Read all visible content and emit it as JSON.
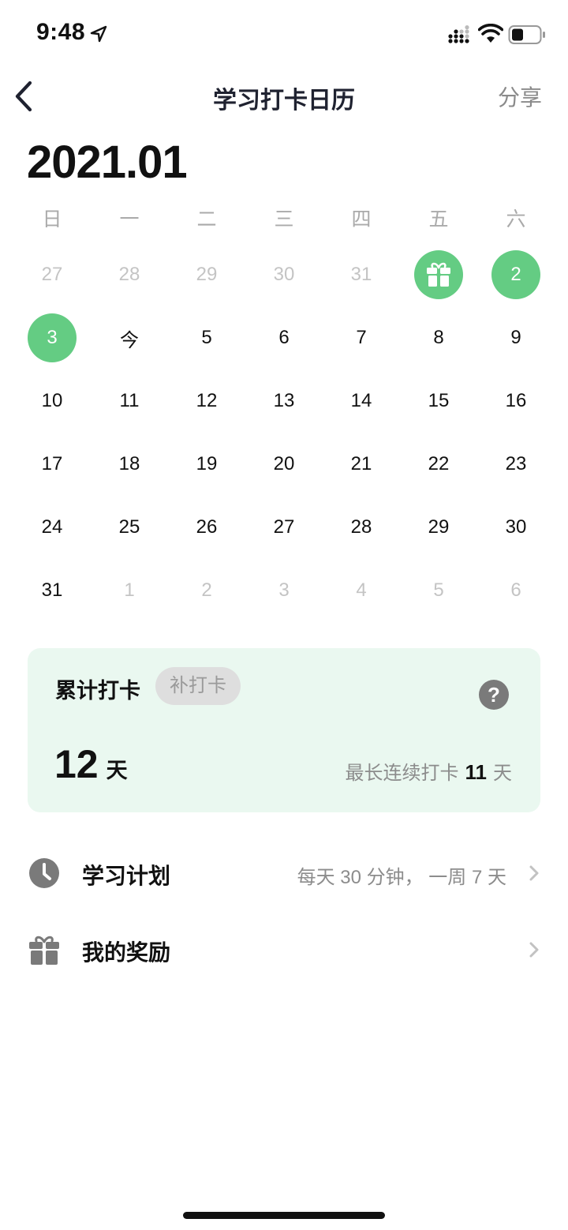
{
  "status_bar": {
    "time": "9:48"
  },
  "nav": {
    "title": "学习打卡日历",
    "share_label": "分享"
  },
  "calendar": {
    "month_title": "2021.01",
    "weekdays": [
      "日",
      "一",
      "二",
      "三",
      "四",
      "五",
      "六"
    ],
    "days": [
      {
        "label": "27",
        "muted": true
      },
      {
        "label": "28",
        "muted": true
      },
      {
        "label": "29",
        "muted": true
      },
      {
        "label": "30",
        "muted": true
      },
      {
        "label": "31",
        "muted": true
      },
      {
        "label": "",
        "checked": true,
        "gift": true
      },
      {
        "label": "2",
        "checked": true
      },
      {
        "label": "3",
        "checked": true
      },
      {
        "label": "今",
        "today": true
      },
      {
        "label": "5"
      },
      {
        "label": "6"
      },
      {
        "label": "7"
      },
      {
        "label": "8"
      },
      {
        "label": "9"
      },
      {
        "label": "10"
      },
      {
        "label": "11"
      },
      {
        "label": "12"
      },
      {
        "label": "13"
      },
      {
        "label": "14"
      },
      {
        "label": "15"
      },
      {
        "label": "16"
      },
      {
        "label": "17"
      },
      {
        "label": "18"
      },
      {
        "label": "19"
      },
      {
        "label": "20"
      },
      {
        "label": "21"
      },
      {
        "label": "22"
      },
      {
        "label": "23"
      },
      {
        "label": "24"
      },
      {
        "label": "25"
      },
      {
        "label": "26"
      },
      {
        "label": "27"
      },
      {
        "label": "28"
      },
      {
        "label": "29"
      },
      {
        "label": "30"
      },
      {
        "label": "31"
      },
      {
        "label": "1",
        "muted": true
      },
      {
        "label": "2",
        "muted": true
      },
      {
        "label": "3",
        "muted": true
      },
      {
        "label": "4",
        "muted": true
      },
      {
        "label": "5",
        "muted": true
      },
      {
        "label": "6",
        "muted": true
      }
    ],
    "checked_color": "#64cc83"
  },
  "summary": {
    "label": "累计打卡",
    "makeup_label": "补打卡",
    "help_label": "?",
    "total_value": "12",
    "total_unit": "天",
    "streak_label": "最长连续打卡",
    "streak_value": "11",
    "streak_unit": "天",
    "card_color": "#eaf8f0"
  },
  "list": {
    "plan": {
      "label": "学习计划",
      "value": "每天 30 分钟， 一周 7 天",
      "icon": "clock-icon"
    },
    "reward": {
      "label": "我的奖励",
      "icon": "gift-icon"
    }
  }
}
